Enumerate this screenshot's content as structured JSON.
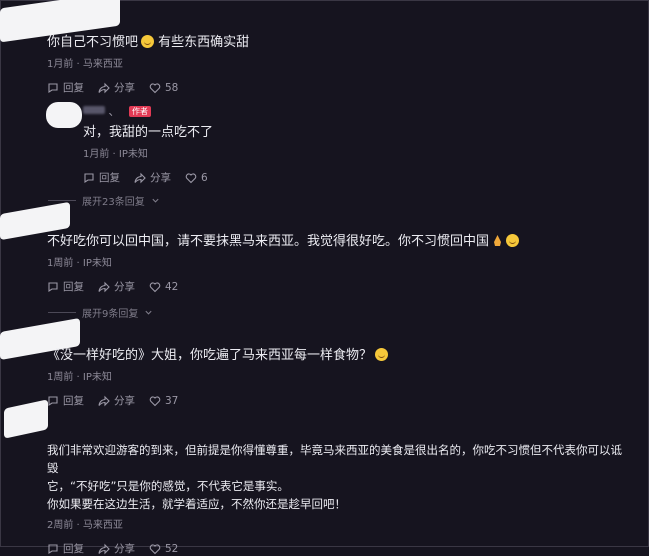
{
  "comments": [
    {
      "text": "你自己不习惯吧",
      "text2": " 有些东西确实甜",
      "meta": "1月前 · 马来西亚",
      "reply": "回复",
      "share": "分享",
      "likes": "58"
    },
    {
      "name_suffix": "、",
      "badge": "作者",
      "text": "对，我甜的一点吃不了",
      "meta": "1月前 · IP未知",
      "reply": "回复",
      "share": "分享",
      "likes": "6",
      "expand": "展开23条回复"
    },
    {
      "text": "不好吃你可以回中国，请不要抹黑马来西亚。我觉得很好吃。你不习惯回中国",
      "meta": "1周前 · IP未知",
      "reply": "回复",
      "share": "分享",
      "likes": "42",
      "expand": "展开9条回复"
    },
    {
      "text": "《没一样好吃的》大姐，你吃遍了马来西亚每一样食物？",
      "meta": "1周前 · IP未知",
      "reply": "回复",
      "share": "分享",
      "likes": "37"
    },
    {
      "text_line1": "我们非常欢迎游客的到来，但前提是你得懂尊重，毕竟马来西亚的美食是很出名的，你吃不习惯但不代表你可以诋毁",
      "text_line2": "它，“不好吃”只是你的感觉，不代表它是事实。",
      "text_line3": "你如果要在这边生活，就学着适应，不然你还是趁早回吧！",
      "meta": "2周前 · 马来西亚",
      "reply": "回复",
      "share": "分享",
      "likes": "52"
    }
  ],
  "icons": [
    "reply-icon",
    "share-icon",
    "like-icon",
    "chevron-down-icon"
  ],
  "colors": {
    "background": "#16141f",
    "badge": "#e23a55",
    "text": "#ececf2",
    "muted": "#8d8a98"
  }
}
